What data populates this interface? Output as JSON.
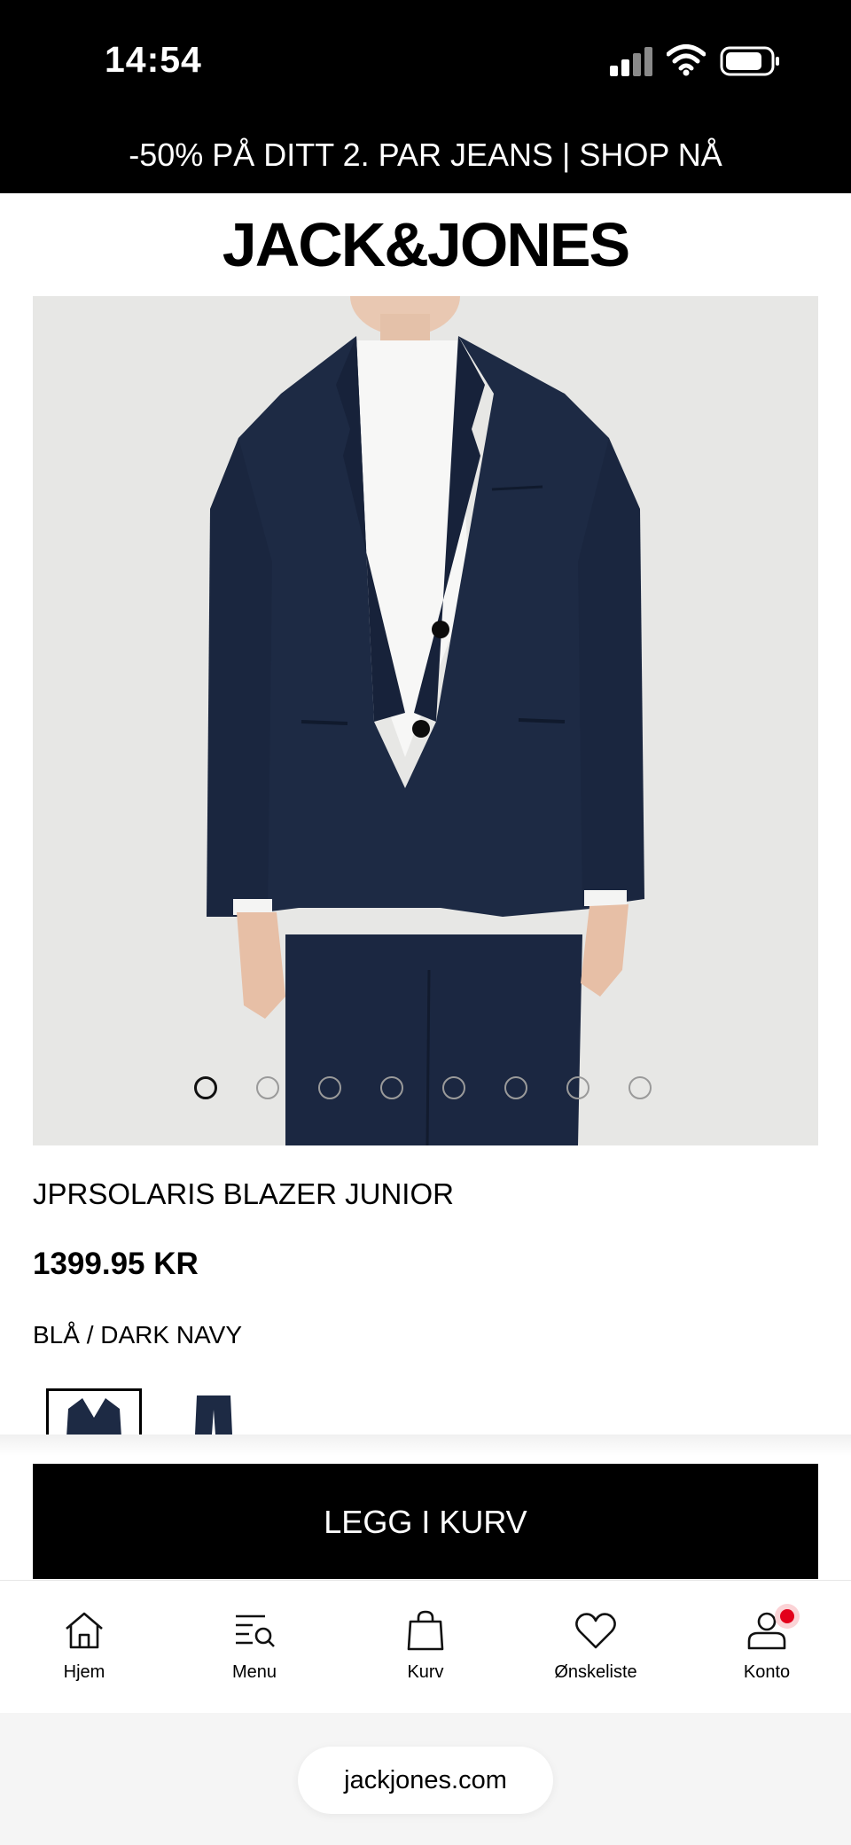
{
  "status_bar": {
    "time": "14:54"
  },
  "promo": {
    "text": "-50% PÅ DITT 2. PAR JEANS | SHOP NÅ"
  },
  "header": {
    "brand": "JACK&JONES"
  },
  "product": {
    "name": "JPRSOLARIS BLAZER JUNIOR",
    "price": "1399.95 KR",
    "color": "BLÅ / DARK NAVY",
    "image_count": 8,
    "active_image": 1
  },
  "cta": {
    "label": "LEGG I KURV"
  },
  "nav": {
    "items": [
      {
        "label": "Hjem",
        "icon": "home-icon"
      },
      {
        "label": "Menu",
        "icon": "menu-search-icon"
      },
      {
        "label": "Kurv",
        "icon": "bag-icon"
      },
      {
        "label": "Ønskeliste",
        "icon": "heart-icon"
      },
      {
        "label": "Konto",
        "icon": "account-icon"
      }
    ]
  },
  "browser": {
    "url": "jackjones.com"
  },
  "colors": {
    "brand_black": "#000000",
    "badge_red": "#e3001b",
    "image_bg": "#e7e7e5",
    "suit_navy": "#1d2a44"
  }
}
